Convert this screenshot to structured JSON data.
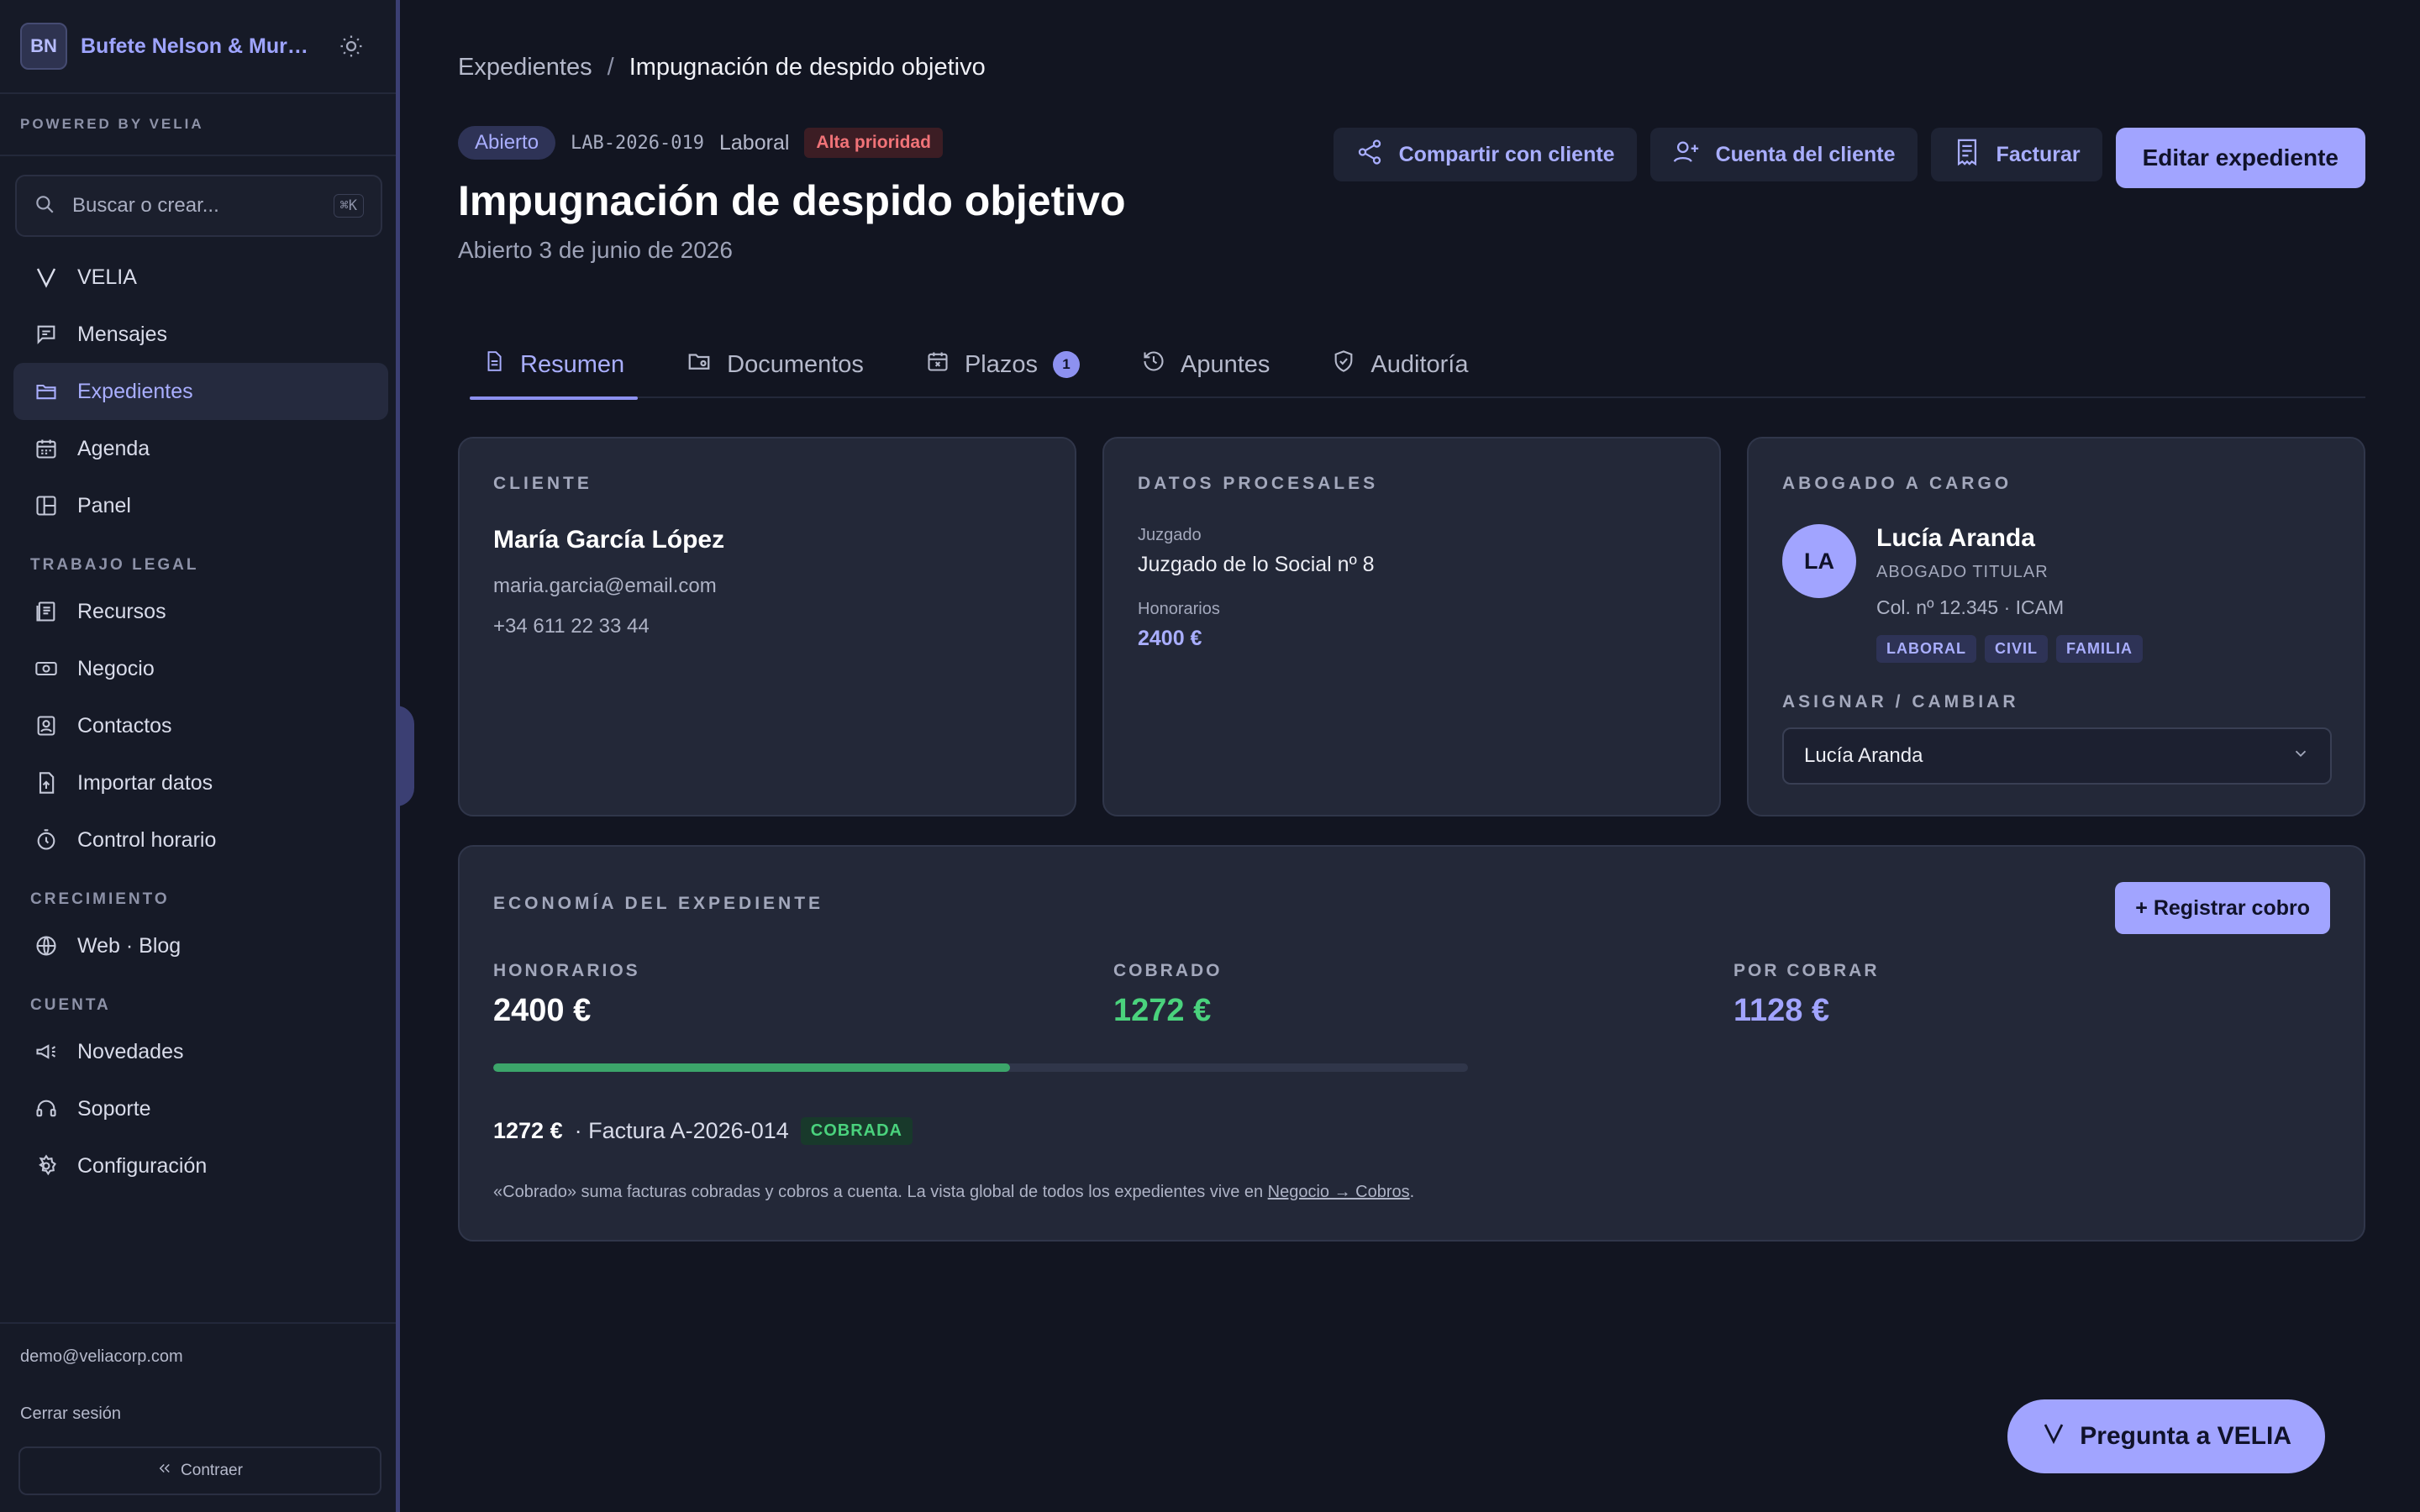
{
  "sidebar": {
    "logo_initials": "BN",
    "firm_name": "Bufete Nelson & Murdock",
    "powered_by": "POWERED BY VELIA",
    "search_placeholder": "Buscar o crear...",
    "search_shortcut": "⌘K",
    "velia_label": "VELIA",
    "items_main": [
      {
        "label": "Mensajes",
        "icon": "messages-icon"
      },
      {
        "label": "Expedientes",
        "icon": "folder-icon",
        "active": true
      },
      {
        "label": "Agenda",
        "icon": "calendar-icon"
      },
      {
        "label": "Panel",
        "icon": "panel-icon"
      }
    ],
    "section_legal": "TRABAJO LEGAL",
    "items_legal": [
      {
        "label": "Recursos",
        "icon": "book-icon"
      },
      {
        "label": "Negocio",
        "icon": "money-icon"
      },
      {
        "label": "Contactos",
        "icon": "contacts-icon"
      },
      {
        "label": "Importar datos",
        "icon": "import-icon"
      },
      {
        "label": "Control horario",
        "icon": "timer-icon"
      }
    ],
    "section_growth": "CRECIMIENTO",
    "items_growth": [
      {
        "label": "Web · Blog",
        "icon": "globe-icon"
      }
    ],
    "section_account": "CUENTA",
    "items_account": [
      {
        "label": "Novedades",
        "icon": "megaphone-icon"
      },
      {
        "label": "Soporte",
        "icon": "support-icon"
      },
      {
        "label": "Configuración",
        "icon": "gear-icon"
      }
    ],
    "user_email": "demo@veliacorp.com",
    "logout": "Cerrar sesión",
    "collapse": "Contraer"
  },
  "breadcrumb": {
    "parent": "Expedientes",
    "separator": "/",
    "current": "Impugnación de despido objetivo"
  },
  "case": {
    "status": "Abierto",
    "code": "LAB-2026-019",
    "area": "Laboral",
    "priority": "Alta prioridad",
    "title": "Impugnación de despido objetivo",
    "opened": "Abierto 3 de junio de 2026"
  },
  "actions": {
    "share": "Compartir con cliente",
    "client_account": "Cuenta del cliente",
    "invoice": "Facturar",
    "edit": "Editar expediente"
  },
  "tabs": [
    {
      "label": "Resumen",
      "active": true
    },
    {
      "label": "Documentos"
    },
    {
      "label": "Plazos",
      "badge": "1"
    },
    {
      "label": "Apuntes"
    },
    {
      "label": "Auditoría"
    }
  ],
  "client": {
    "label": "CLIENTE",
    "name": "María García López",
    "email": "maria.garcia@email.com",
    "phone": "+34 611 22 33 44"
  },
  "procedural": {
    "label": "DATOS PROCESALES",
    "court_label": "Juzgado",
    "court": "Juzgado de lo Social nº 8",
    "fees_label": "Honorarios",
    "fees": "2400 €"
  },
  "lawyer": {
    "label": "ABOGADO A CARGO",
    "initials": "LA",
    "name": "Lucía Aranda",
    "role": "ABOGADO TITULAR",
    "college": "Col. nº 12.345 · ICAM",
    "specialties": [
      "LABORAL",
      "CIVIL",
      "FAMILIA"
    ],
    "assign_label": "ASIGNAR / CAMBIAR",
    "selected": "Lucía Aranda"
  },
  "economy": {
    "label": "ECONOMÍA DEL EXPEDIENTE",
    "register": "+ Registrar cobro",
    "fees_label": "HONORARIOS",
    "fees": "2400 €",
    "collected_label": "COBRADO",
    "collected": "1272 €",
    "pending_label": "POR COBRAR",
    "pending": "1128 €",
    "progress": 0.53,
    "invoice_amount": "1272 €",
    "invoice_text": "· Factura A-2026-014",
    "invoice_status": "COBRADA",
    "note": "«Cobrado» suma facturas cobradas y cobros a cuenta. La vista global de todos los expedientes vive en ",
    "note_link": "Negocio → Cobros",
    "note_end": "."
  },
  "colors": {
    "accent": "#a1a4ff",
    "success": "#4ad27d",
    "danger": "#f17378",
    "background": "#121521"
  },
  "assistant": {
    "label": "Pregunta a VELIA"
  }
}
